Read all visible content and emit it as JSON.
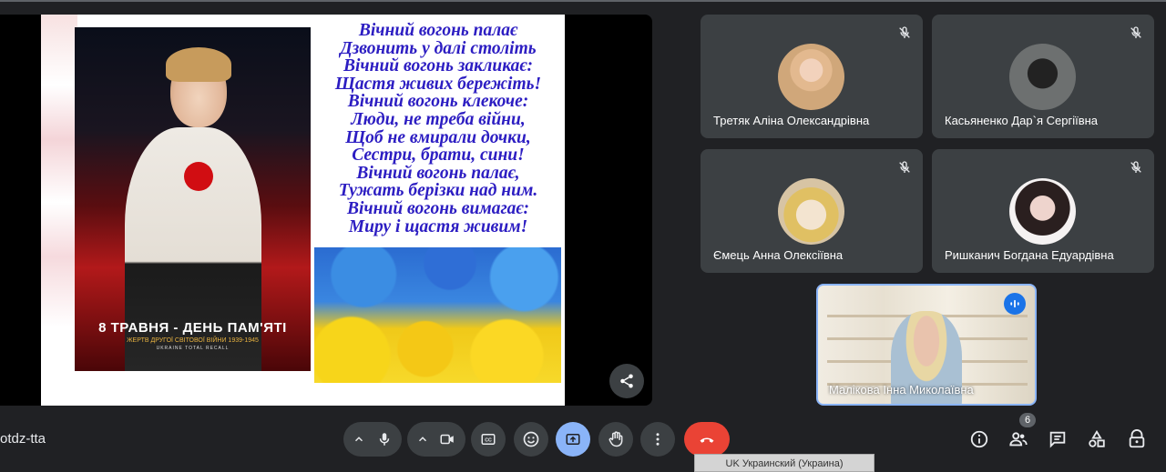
{
  "meeting": {
    "code": "otdz-tta"
  },
  "slide": {
    "photo_title": "8 ТРАВНЯ - ДЕНЬ ПАМ'ЯТІ",
    "photo_sub": "ЖЕРТВ ДРУГОЇ СВІТОВОЇ ВІЙНИ 1939-1945",
    "photo_brand": "UKRAINE TOTAL RECALL",
    "poem": [
      "Вічний вогонь палає",
      "Дзвонить у далі століть",
      "Вічний вогонь закликає:",
      "Щастя живих бережіть!",
      "Вічний вогонь клекоче:",
      "Люди, не треба війни,",
      "Щоб не вмирали дочки,",
      "Сестри, брати, сини!",
      "Вічний вогонь палає,",
      "Тужать берізки над ним.",
      "Вічний вогонь вимагає:",
      "Миру і щастя живим!"
    ]
  },
  "participants": [
    {
      "name": "Третяк Аліна Олександрівна",
      "muted": true
    },
    {
      "name": "Касьяненко Дар`я Сергіївна",
      "muted": true
    },
    {
      "name": "Ємець Анна Олексіївна",
      "muted": true
    },
    {
      "name": "Ришканич Богдана Едуардівна",
      "muted": true
    }
  ],
  "speaker": {
    "name": "Малікова Інна Миколаївна"
  },
  "people_count": "6",
  "language_bar": "UK Украинский (Украина)",
  "colors": {
    "accent": "#8ab4f8",
    "hangup": "#ea4335",
    "tile": "#3c4043",
    "background": "#202124"
  }
}
